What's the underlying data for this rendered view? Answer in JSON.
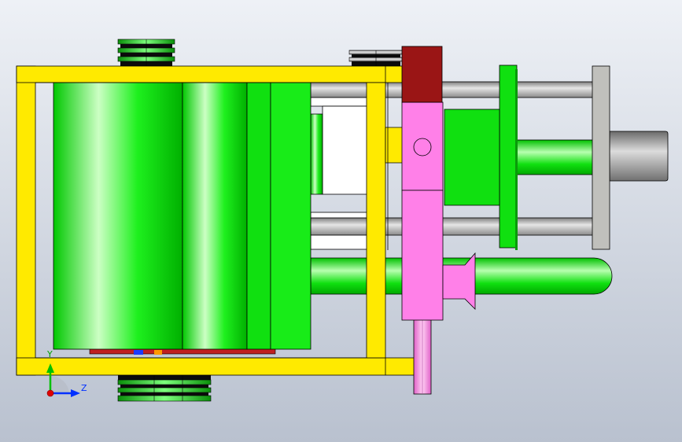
{
  "viewport": {
    "background_top": "#eef1f6",
    "background_bottom": "#b9c1cf"
  },
  "colors": {
    "frame_yellow": "#ffea00",
    "motor_green": "#00ee00",
    "bracket_pink": "#ff80e8",
    "cap_red": "#9a1515",
    "rod_gray": "#a8a8a8",
    "plate_gray": "#c0c0bc",
    "outline": "#000000"
  },
  "triad": {
    "y_label": "Y",
    "z_label": "Z",
    "y_color": "#00c000",
    "z_color": "#0030ff",
    "origin_color": "#e00000"
  }
}
